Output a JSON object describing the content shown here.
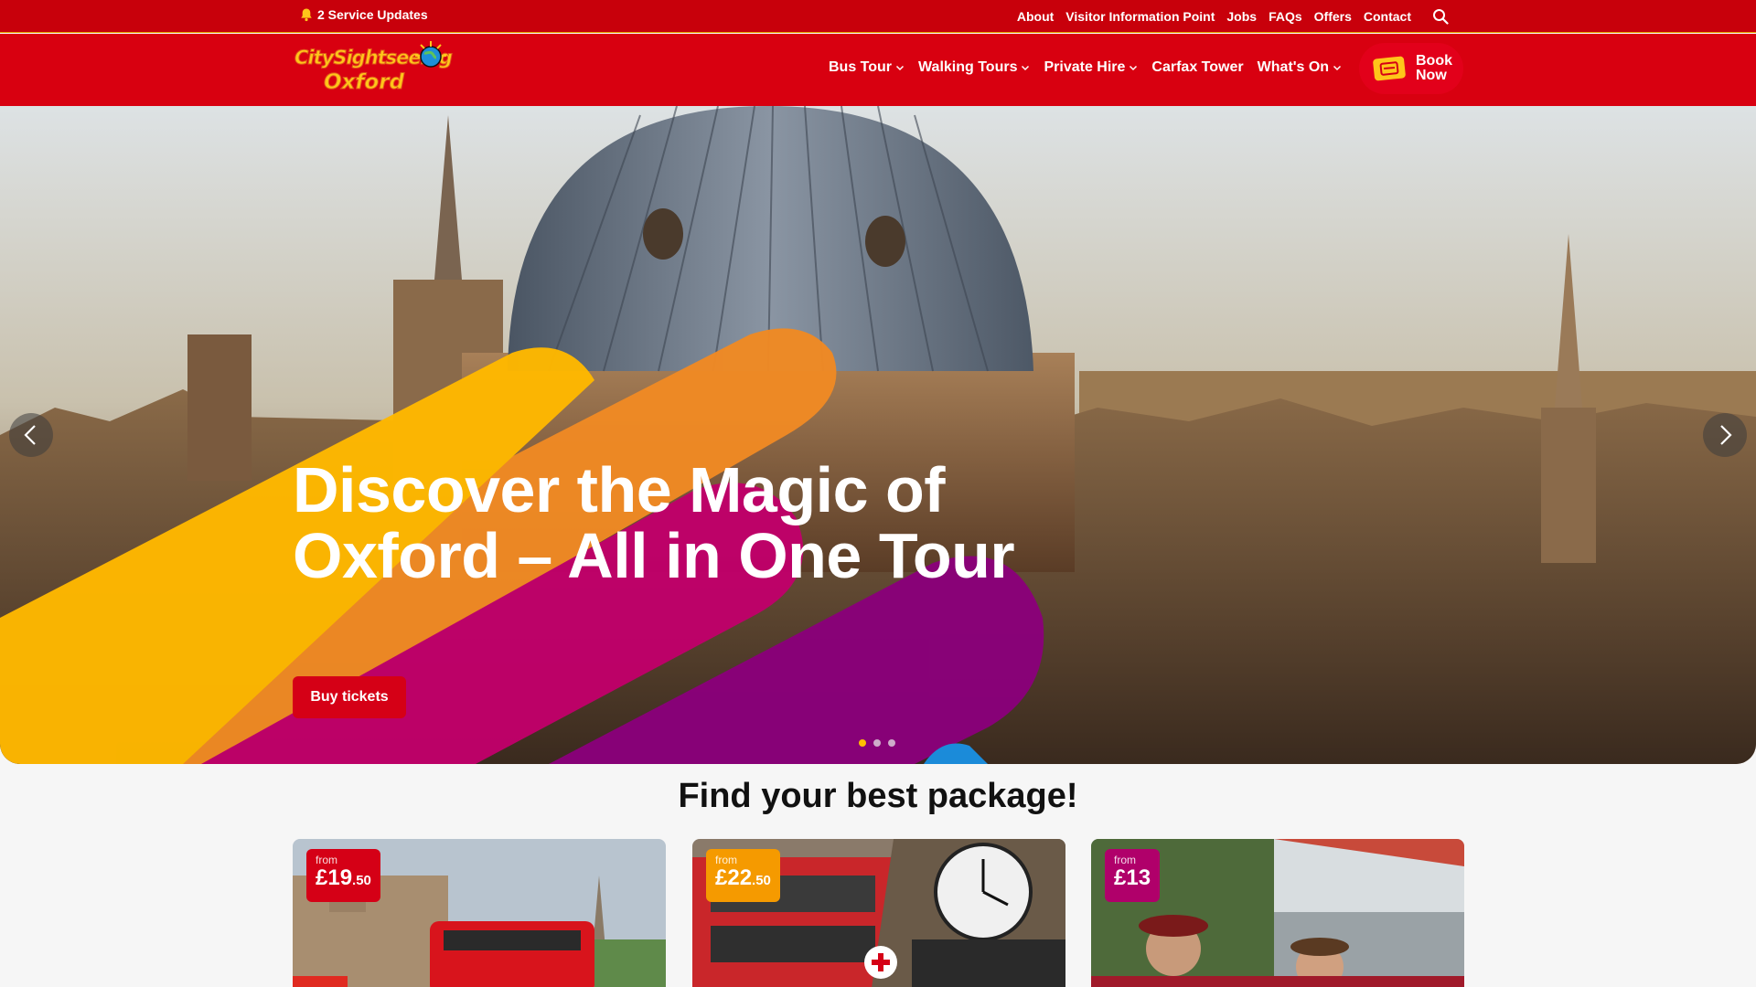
{
  "topbar": {
    "updates_label": "2 Service Updates",
    "links": [
      "About",
      "Visitor Information Point",
      "Jobs",
      "FAQs",
      "Offers",
      "Contact"
    ]
  },
  "logo": {
    "line1": "CitySightseeing",
    "line2": "Oxford"
  },
  "nav": {
    "items": [
      {
        "label": "Bus Tour",
        "dropdown": true
      },
      {
        "label": "Walking Tours",
        "dropdown": true
      },
      {
        "label": "Private Hire",
        "dropdown": true
      },
      {
        "label": "Carfax Tower",
        "dropdown": false
      },
      {
        "label": "What's On",
        "dropdown": true
      }
    ],
    "book_line1": "Book",
    "book_line2": "Now"
  },
  "hero": {
    "title": "Discover the Magic of Oxford – All in One Tour",
    "button": "Buy tickets",
    "slides": 3,
    "active_slide": 1
  },
  "packages": {
    "title": "Find your best package!",
    "cards": [
      {
        "from": "from",
        "pounds": "£19",
        "pence": ".50",
        "badge_color": "#d50016"
      },
      {
        "from": "from",
        "pounds": "£22",
        "pence": ".50",
        "badge_color": "#f59a00"
      },
      {
        "from": "from",
        "pounds": "£13",
        "pence": "",
        "badge_color": "#b0006a"
      }
    ]
  },
  "colors": {
    "brand_red": "#d80010",
    "topbar_red": "#c8000b",
    "accent_yellow": "#ffbf00",
    "accent_orange": "#f08a24",
    "accent_magenta": "#c0006a",
    "accent_purple": "#7a0075"
  }
}
